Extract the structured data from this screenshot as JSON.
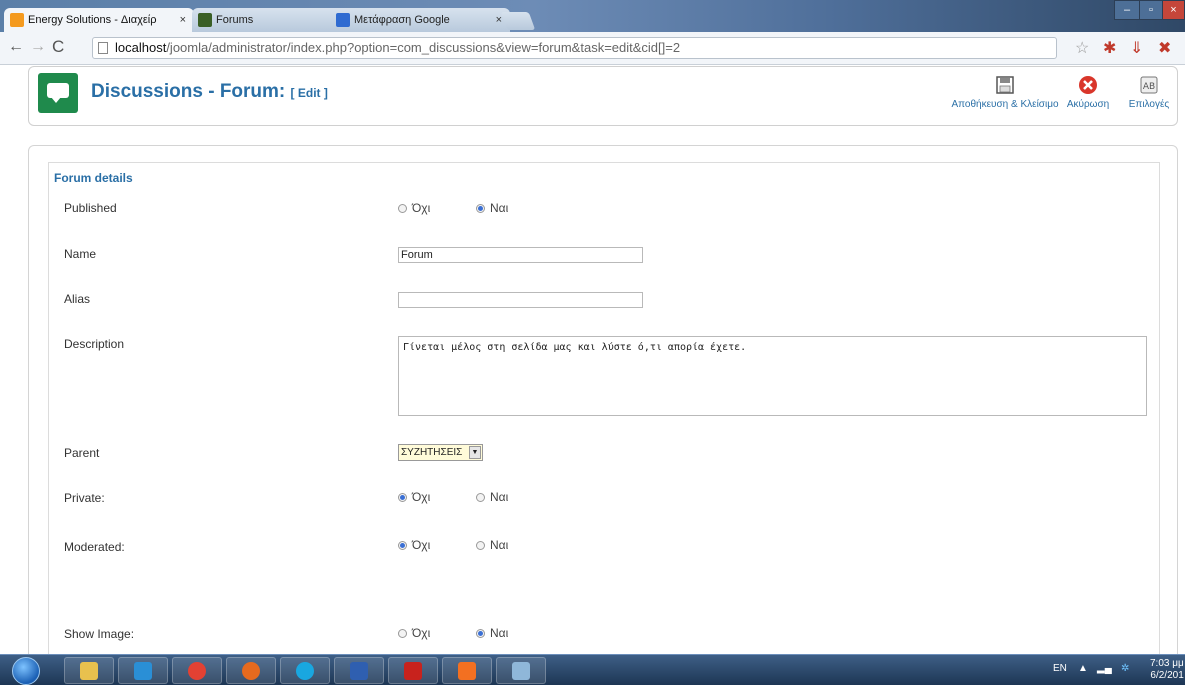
{
  "browser": {
    "tabs": [
      {
        "title": "Energy Solutions - Διαχείρ",
        "active": true,
        "favicon_color": "#f49a1f"
      },
      {
        "title": "Forums",
        "active": false,
        "favicon_color": "#3a5f26"
      },
      {
        "title": "Μετάφραση Google",
        "active": false,
        "favicon_color": "#2f6bd1"
      }
    ],
    "tab_close_glyph": "×",
    "url_host": "localhost",
    "url_path": "/joomla/administrator/index.php?option=com_discussions&view=forum&task=edit&cid[]=2",
    "window_controls": [
      "–",
      "▫",
      "×"
    ]
  },
  "header": {
    "title": "Discussions - Forum:",
    "edit_tag": "[ Edit ]",
    "buttons": [
      {
        "label": "Αποθήκευση & Κλείσιμο",
        "icon": "save-icon"
      },
      {
        "label": "Ακύρωση",
        "icon": "cancel-icon"
      },
      {
        "label": "Επιλογές",
        "icon": "options-icon"
      }
    ]
  },
  "form": {
    "legend": "Forum details",
    "published": {
      "label": "Published",
      "options": [
        "Όχι",
        "Ναι"
      ],
      "selected": "Ναι"
    },
    "name": {
      "label": "Name",
      "value": "Forum"
    },
    "alias": {
      "label": "Alias",
      "value": ""
    },
    "description": {
      "label": "Description",
      "value": "Γίνεται μέλος στη σελίδα μας και λύστε ό,τι απορία έχετε."
    },
    "parent": {
      "label": "Parent",
      "value": "ΣΥΖΗΤΗΣΕΙΣ"
    },
    "private": {
      "label": "Private:",
      "options": [
        "Όχι",
        "Ναι"
      ],
      "selected": "Όχι"
    },
    "moderated": {
      "label": "Moderated:",
      "options": [
        "Όχι",
        "Ναι"
      ],
      "selected": "Όχι"
    },
    "show_image": {
      "label": "Show Image:",
      "options": [
        "Όχι",
        "Ναι"
      ],
      "selected": "Ναι"
    }
  },
  "taskbar": {
    "language": "EN",
    "time": "7:03 μμ",
    "date": "6/2/201"
  },
  "colors": {
    "accent": "#2a6fa6",
    "logo_green": "#1f8a4c",
    "cancel_red": "#d9362b"
  }
}
